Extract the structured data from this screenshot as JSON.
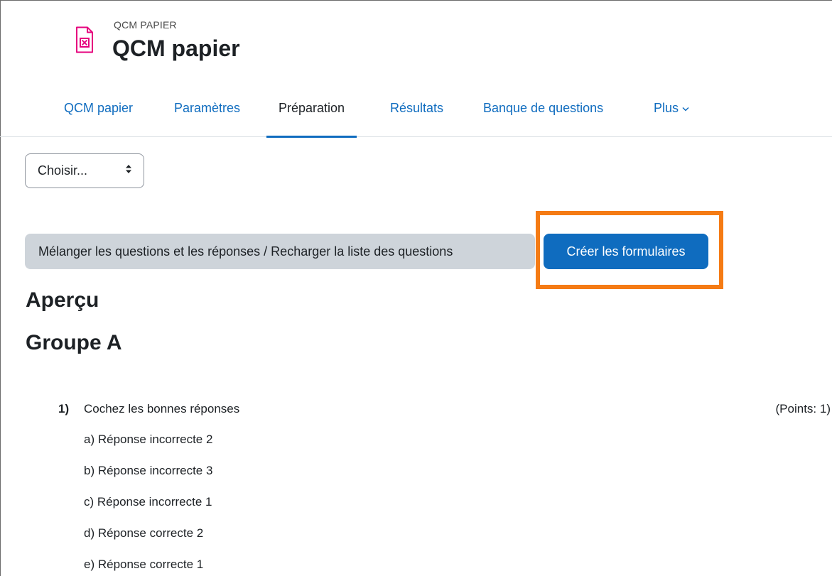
{
  "header": {
    "pre_title": "QCM PAPIER",
    "title": "QCM papier",
    "icon": "paper-quiz-icon",
    "icon_color": "#e6007e"
  },
  "tabs": [
    {
      "label": "QCM papier",
      "active": false
    },
    {
      "label": "Paramètres",
      "active": false
    },
    {
      "label": "Préparation",
      "active": true
    },
    {
      "label": "Résultats",
      "active": false
    },
    {
      "label": "Banque de questions",
      "active": false
    },
    {
      "label": "Plus",
      "active": false
    }
  ],
  "select": {
    "value": "Choisir..."
  },
  "buttons": {
    "shuffle": "Mélanger les questions et les réponses / Recharger la liste des questions",
    "create": "Créer les formulaires"
  },
  "colors": {
    "primary": "#0f6cbf",
    "highlight": "#f57b14",
    "secondary_bg": "#ced4da"
  },
  "preview": {
    "heading": "Aperçu",
    "group": "Groupe A"
  },
  "question": {
    "number": "1)",
    "text": "Cochez les bonnes réponses",
    "points": "(Points: 1)",
    "answers": [
      "a)  Réponse incorrecte 2",
      "b)  Réponse incorrecte 3",
      "c)  Réponse incorrecte 1",
      "d)  Réponse correcte 2",
      "e)  Réponse correcte 1"
    ]
  }
}
